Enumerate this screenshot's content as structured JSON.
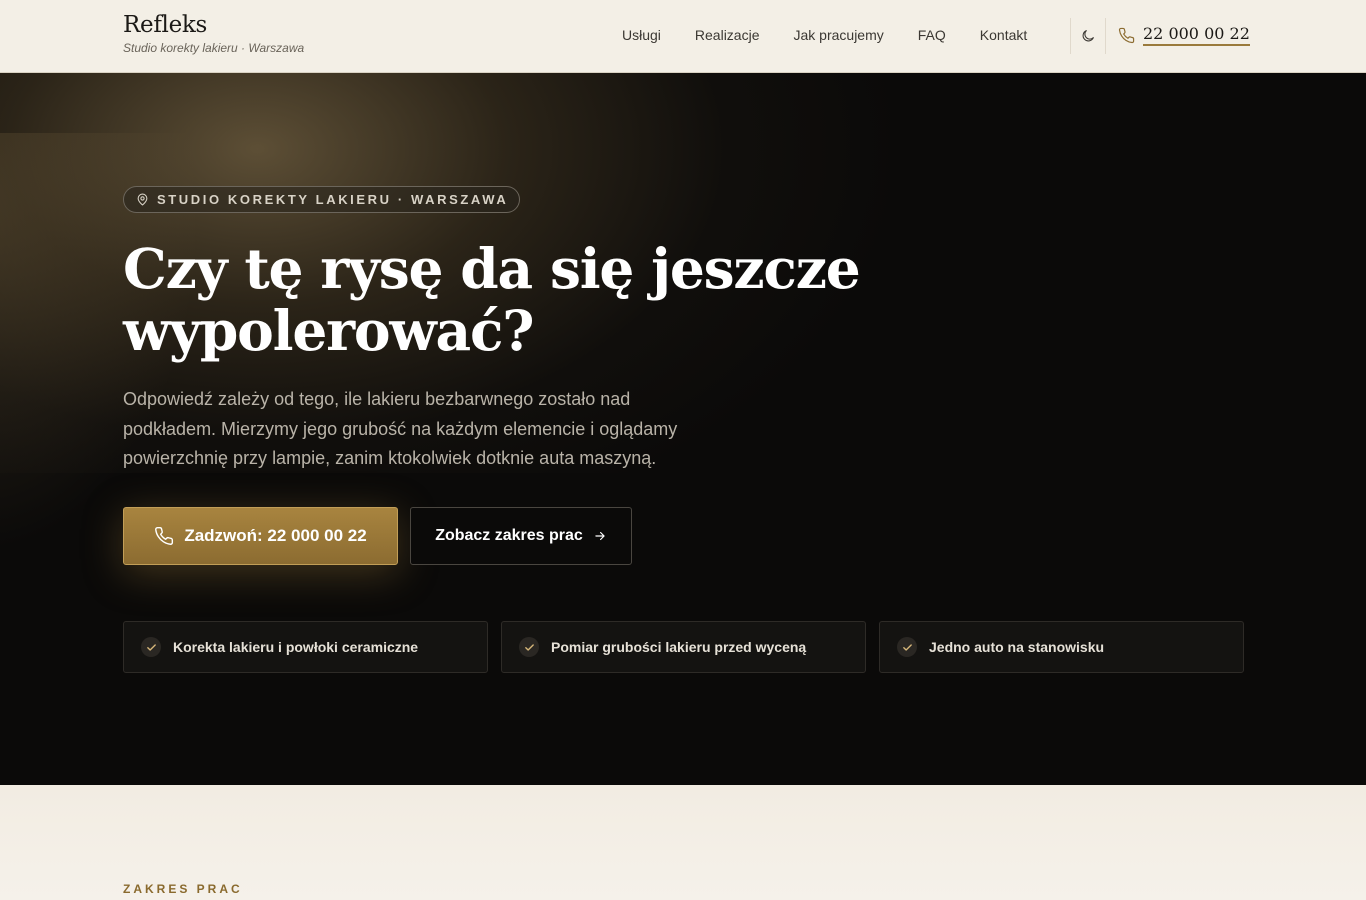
{
  "header": {
    "brand_name": "Refleks",
    "brand_tagline": "Studio korekty lakieru · Warszawa",
    "nav": [
      "Usługi",
      "Realizacje",
      "Jak pracujemy",
      "FAQ",
      "Kontakt"
    ],
    "theme_toggle_icon": "moon-icon",
    "phone_icon": "phone-icon",
    "phone": "22 000 00 22"
  },
  "hero": {
    "location_icon": "map-pin-icon",
    "eyebrow": "STUDIO KOREKTY LAKIERU · WARSZAWA",
    "title": "Czy tę rysę da się jeszcze wypolerować?",
    "description": "Odpowiedź zależy od tego, ile lakieru bezbarwnego zostało nad podkładem. Mierzymy jego grubość na każdym elemencie i oglądamy powierzchnię przy lampie, zanim ktokolwiek dotknie auta maszyną.",
    "cta_primary": "Zadzwoń: 22 000 00 22",
    "cta_secondary": "Zobacz zakres prac",
    "features": [
      "Korekta lakieru i powłoki ceramiczne",
      "Pomiar grubości lakieru przed wyceną",
      "Jedno auto na stanowisku"
    ]
  },
  "section": {
    "label": "ZAKRES PRAC"
  },
  "colors": {
    "accent": "#a8843f",
    "hero_bg": "#0b0a09",
    "header_bg": "#f3efe6"
  }
}
